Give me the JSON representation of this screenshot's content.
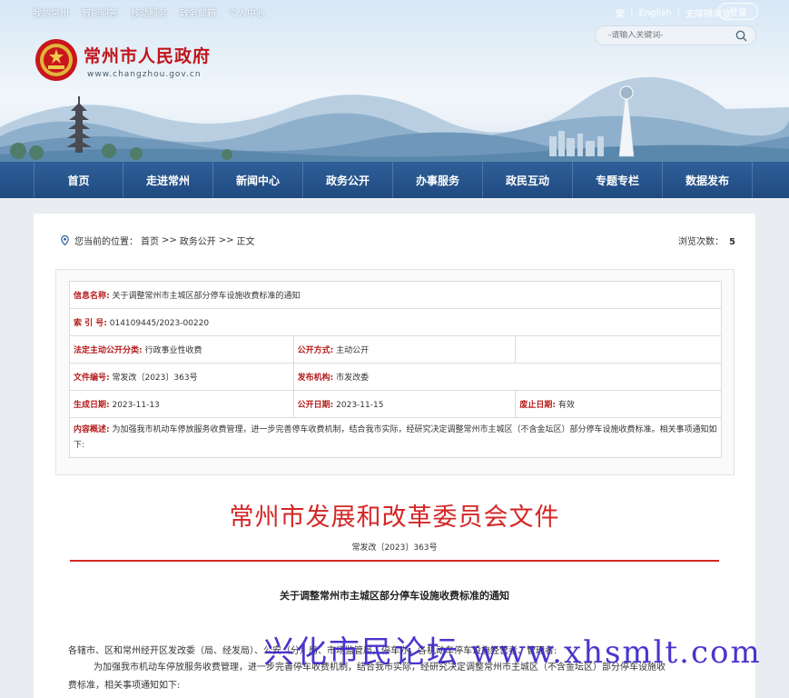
{
  "top_links": [
    "我的常州",
    "智能问答",
    "移动服务",
    "政务邮箱",
    "个人中心"
  ],
  "top_right": {
    "traditional": "繁",
    "english": "English",
    "accessibility": "无障碍浏览",
    "login": "登录"
  },
  "search": {
    "placeholder": "-请输入关键词-"
  },
  "site": {
    "title": "常州市人民政府",
    "url": "www.changzhou.gov.cn"
  },
  "nav": [
    "首页",
    "走进常州",
    "新闻中心",
    "政务公开",
    "办事服务",
    "政民互动",
    "专题专栏",
    "数据发布"
  ],
  "breadcrumb": {
    "prefix": "您当前的位置：",
    "home": "首页",
    "sep1": ">>",
    "section": "政务公开",
    "sep2": ">>",
    "current": "正文"
  },
  "views": {
    "label": "浏览次数：",
    "count": "5"
  },
  "info": {
    "name_label": "信息名称:",
    "name": "关于调整常州市主城区部分停车设施收费标准的通知",
    "index_label": "索 引 号:",
    "index": "014109445/2023-00220",
    "category_label": "法定主动公开分类:",
    "category": "行政事业性收费",
    "mode_label": "公开方式:",
    "mode": "主动公开",
    "docno_label": "文件编号:",
    "docno": "常发改〔2023〕363号",
    "org_label": "发布机构:",
    "org": "市发改委",
    "created_label": "生成日期:",
    "created": "2023-11-13",
    "published_label": "公开日期:",
    "published": "2023-11-15",
    "expiry_label": "废止日期:",
    "expiry": "有效",
    "summary_label": "内容概述:",
    "summary": "为加强我市机动车停放服务收费管理，进一步完善停车收费机制，结合我市实际，经研究决定调整常州市主城区（不含金坛区）部分停车设施收费标准。相关事项通知如下:"
  },
  "document": {
    "header": "常州市发展和改革委员会文件",
    "number": "常发改〔2023〕363号",
    "title": "关于调整常州市主城区部分停车设施收费标准的通知",
    "p1": "各辖市、区和常州经开区发改委（局、经发局）、公安（分）局、市场监管局，停车办，各机动车停车设施经营者、管理者:",
    "p2": "为加强我市机动车停放服务收费管理，进一步完善停车收费机制，结合我市实际，经研究决定调整常州市主城区（不含金坛区）部分停车设施收",
    "p3": "费标准，相关事项通知如下:"
  },
  "watermark": "兴化市民论坛 www.xhsmlt.com"
}
